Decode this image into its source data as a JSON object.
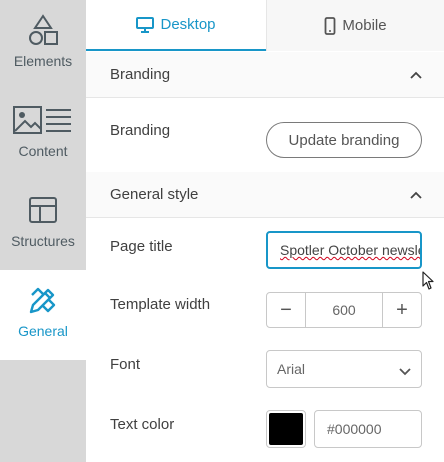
{
  "sidebar": {
    "items": [
      {
        "label": "Elements",
        "icon": "shapes-icon"
      },
      {
        "label": "Content",
        "icon": "image-text-icon"
      },
      {
        "label": "Structures",
        "icon": "layout-icon"
      },
      {
        "label": "General",
        "icon": "pencil-ruler-icon",
        "active": true
      }
    ]
  },
  "tabs": {
    "desktop": "Desktop",
    "mobile": "Mobile"
  },
  "sections": {
    "branding": {
      "title": "Branding",
      "label": "Branding",
      "button": "Update branding"
    },
    "general_style": {
      "title": "General style",
      "page_title_label": "Page title",
      "page_title_value": "Spotler October newsletter",
      "template_width_label": "Template width",
      "template_width_value": "600",
      "minus": "−",
      "plus": "+",
      "font_label": "Font",
      "font_value": "Arial",
      "text_color_label": "Text color",
      "text_color_hex": "#000000"
    }
  },
  "colors": {
    "accent": "#1896c8",
    "sidebar_bg": "#d8d8d8",
    "text_color_swatch": "#000000"
  }
}
